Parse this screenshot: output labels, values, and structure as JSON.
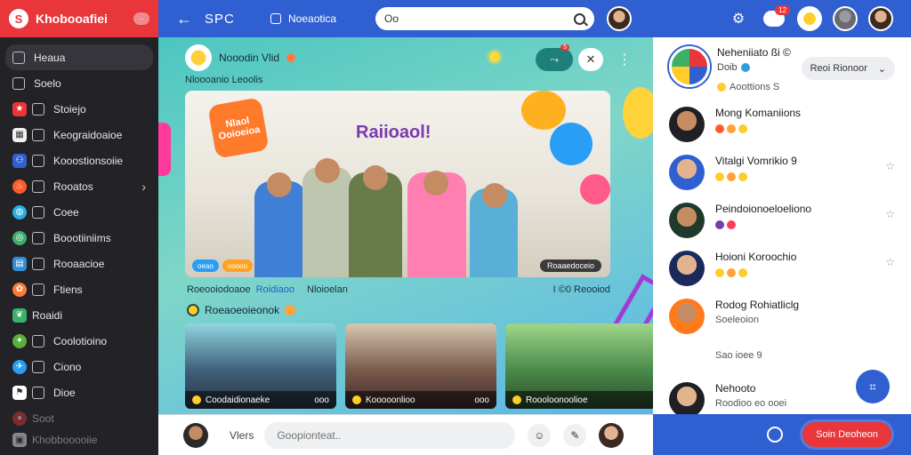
{
  "brand": {
    "name": "Khobooafiei",
    "badge": "··"
  },
  "sidebar": {
    "items": [
      {
        "label": "Heaua",
        "icon": "home-icon",
        "color": "#2a2a2e"
      },
      {
        "label": "Soelo",
        "icon": "grid-icon",
        "color": "#3a3a3e"
      },
      {
        "label": "Stoiejo",
        "icon": "star-icon",
        "color": "#e8363a"
      },
      {
        "label": "Keograidoaioe",
        "icon": "map-icon",
        "color": "#f0f0f0"
      },
      {
        "label": "Kooostionsoiie",
        "icon": "people-icon",
        "color": "#2f5fd0"
      },
      {
        "label": "Rooatos",
        "icon": "flame-icon",
        "color": "#ff5a2a"
      },
      {
        "label": "Coee",
        "icon": "globe-icon",
        "color": "#2ab0e0"
      },
      {
        "label": "Boootiiniims",
        "icon": "circle-icon",
        "color": "#3ab06a"
      },
      {
        "label": "Rooaacioe",
        "icon": "calendar-icon",
        "color": "#2f8fd6"
      },
      {
        "label": "Ftiens",
        "icon": "gift-icon",
        "color": "#ff7a3a"
      },
      {
        "label": "Roaidi",
        "icon": "leaf-icon",
        "color": "#3ab06a"
      },
      {
        "label": "Coolotioino",
        "icon": "shield-icon",
        "color": "#5ab03a"
      },
      {
        "label": "Ciono",
        "icon": "bird-icon",
        "color": "#2a9df4"
      },
      {
        "label": "Dioe",
        "icon": "flag-icon",
        "color": "#ffffff"
      },
      {
        "label": "Soot",
        "icon": "bag-icon",
        "color": "#e8363a"
      },
      {
        "label": "Khobbooooiie",
        "icon": "pin-icon",
        "color": "#ffffff"
      }
    ]
  },
  "topbar": {
    "title": "SPC",
    "messages_label": "Noeaotica",
    "search_value": "Oo",
    "notif_count": "12"
  },
  "post": {
    "author": "Nooodin Vlid",
    "caption": "Nloooanio Leoolis",
    "hero_title": "Raiioaol!",
    "hero_tag": "Nlaol Ooioeioa",
    "hero_badges": [
      "oeao",
      "ooooo"
    ],
    "hero_right_badge": "Roaaedoceio",
    "meta_main": "Roeooiodoaoe",
    "meta_tag": "Roidiaoo",
    "meta_sub": "Nloioelan",
    "meta_time": "I ©0 Reooiod",
    "pa_badge": "5"
  },
  "section": {
    "title": "Roeaoeoieonok"
  },
  "thumbs": [
    {
      "label": "Coodaidionaeke",
      "count": "ooo"
    },
    {
      "label": "Kooooonlioo",
      "count": "ooo"
    },
    {
      "label": "Roooloonoolioe",
      "count": ""
    }
  ],
  "comment_bar": {
    "label": "Vlers",
    "placeholder": "Goopionteat.."
  },
  "rpanel": {
    "profile": {
      "name": "Neheniiato ßi ©",
      "sub": "Doib",
      "reactions": "Aoottions S",
      "button": "Reoi Rionoor"
    },
    "friends": [
      {
        "name": "Mong Komaniions",
        "sub": "",
        "emojis": [
          "#ff5a2a",
          "#ffa23a",
          "#ffcc2a"
        ],
        "star": false
      },
      {
        "name": "Vitalgi Vomrikio 9",
        "sub": "",
        "emojis": [
          "#ffcc2a",
          "#ffa23a",
          "#ffcc2a"
        ],
        "star": true
      },
      {
        "name": "Peindoionoeloeliono",
        "sub": "",
        "emojis": [
          "#7a3ab0",
          "#ff3a5a"
        ],
        "star": true
      },
      {
        "name": "Hoioni Koroochio",
        "sub": "",
        "emojis": [
          "#ffcc2a",
          "#ffa23a",
          "#ffcc2a"
        ],
        "star": true
      },
      {
        "name": "Rodog Rohiatliclg",
        "sub": "Soeleoion",
        "emojis": [
          "#ff7a1a"
        ],
        "star": false
      },
      {
        "name": "",
        "sub": "Sao ioee 9",
        "emojis": [],
        "star": false
      },
      {
        "name": "Nehooto",
        "sub": "Roodioo eo ooei",
        "emojis": [],
        "star": false
      }
    ]
  },
  "rbar": {
    "button": "Soin Deoheon"
  },
  "colors": {
    "accent": "#2f5fd0",
    "brand": "#e8363a",
    "sidebar": "#232327"
  }
}
